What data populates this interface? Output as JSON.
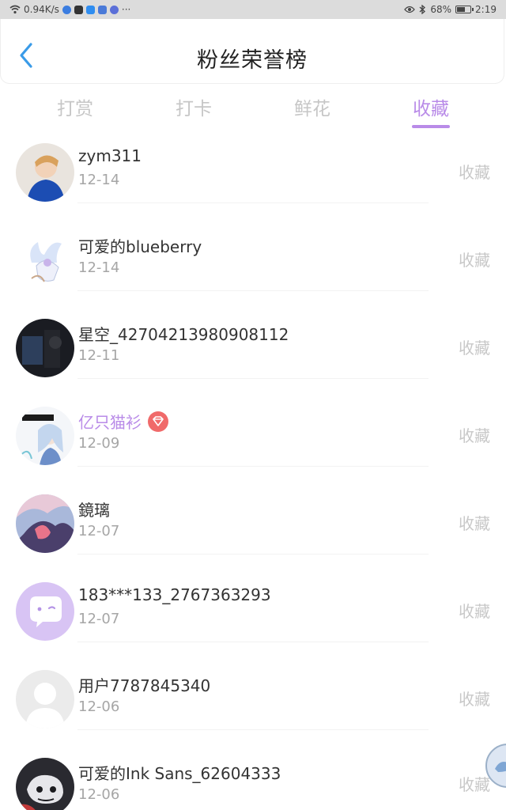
{
  "status_bar": {
    "speed": "0.94K/s",
    "more": "···",
    "battery": "68%",
    "battery_level": 0.68,
    "time": "2:19"
  },
  "header": {
    "title": "粉丝荣誉榜"
  },
  "tabs": [
    {
      "label": "打赏",
      "active": false
    },
    {
      "label": "打卡",
      "active": false
    },
    {
      "label": "鲜花",
      "active": false
    },
    {
      "label": "收藏",
      "active": true
    }
  ],
  "colors": {
    "accent": "#b98be8",
    "badge": "#f06a6a",
    "statusbar_bg": "#dcdcdc"
  },
  "fans": [
    {
      "name": "zym311",
      "date": "12-14",
      "action": "收藏",
      "avatar": "photo-girl-avatar"
    },
    {
      "name": "可爱的blueberry",
      "date": "12-14",
      "action": "收藏",
      "avatar": "anime-figure-avatar"
    },
    {
      "name": "星空_42704213980908112",
      "date": "12-11",
      "action": "收藏",
      "avatar": "dark-photo-avatar"
    },
    {
      "name": "亿只猫衫",
      "date": "12-09",
      "action": "收藏",
      "avatar": "anime-girl-avatar",
      "vip": true,
      "badge": "diamond-badge-icon"
    },
    {
      "name": "鏡璃",
      "date": "12-07",
      "action": "收藏",
      "avatar": "colorful-art-avatar"
    },
    {
      "name": "183***133_2767363293",
      "date": "12-07",
      "action": "收藏",
      "avatar": "chat-bubble-default-avatar"
    },
    {
      "name": "用户7787845340",
      "date": "12-06",
      "action": "收藏",
      "avatar": "person-silhouette-avatar"
    },
    {
      "name": "可爱的Ink Sans_62604333",
      "date": "12-06",
      "action": "收藏",
      "avatar": "ink-sans-avatar"
    }
  ]
}
